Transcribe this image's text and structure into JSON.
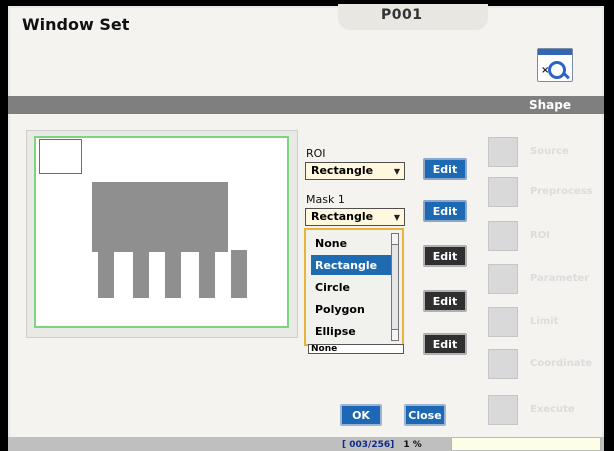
{
  "window": {
    "title": "Window Set",
    "page_no": "P001"
  },
  "toolbar": {
    "tool_icon_name": "image-settings-icon"
  },
  "shape_bar": {
    "label": "Shape"
  },
  "controls": {
    "roi": {
      "label": "ROI",
      "value": "Rectangle",
      "edit": "Edit"
    },
    "mask1": {
      "label": "Mask 1",
      "value": "Rectangle",
      "edit": "Edit"
    },
    "extra_edit_1": "Edit",
    "extra_edit_2": "Edit",
    "extra_edit_3": "Edit"
  },
  "dropdown_open": {
    "items": [
      "None",
      "Rectangle",
      "Circle",
      "Polygon",
      "Ellipse"
    ],
    "selected": "Rectangle",
    "bottom_value": "None"
  },
  "sidebar": {
    "items": [
      {
        "label": "Source",
        "icon": "source-icon"
      },
      {
        "label": "Preprocess",
        "icon": "preprocess-icon"
      },
      {
        "label": "ROI",
        "icon": "roi-icon"
      },
      {
        "label": "Parameter",
        "icon": "parameter-icon"
      },
      {
        "label": "Limit",
        "icon": "limit-icon"
      },
      {
        "label": "Coordinate",
        "icon": "coordinate-icon"
      },
      {
        "label": "Execute",
        "icon": "execute-icon"
      }
    ]
  },
  "footer": {
    "ok": "OK",
    "close": "Close"
  },
  "status": {
    "counter": "[ 003/256]",
    "percent": "1 %"
  },
  "colors": {
    "accent": "#1d68b4",
    "highlight": "#e7b43c",
    "roi_green": "#7ed37e",
    "roi_red": "#e53b3b"
  }
}
